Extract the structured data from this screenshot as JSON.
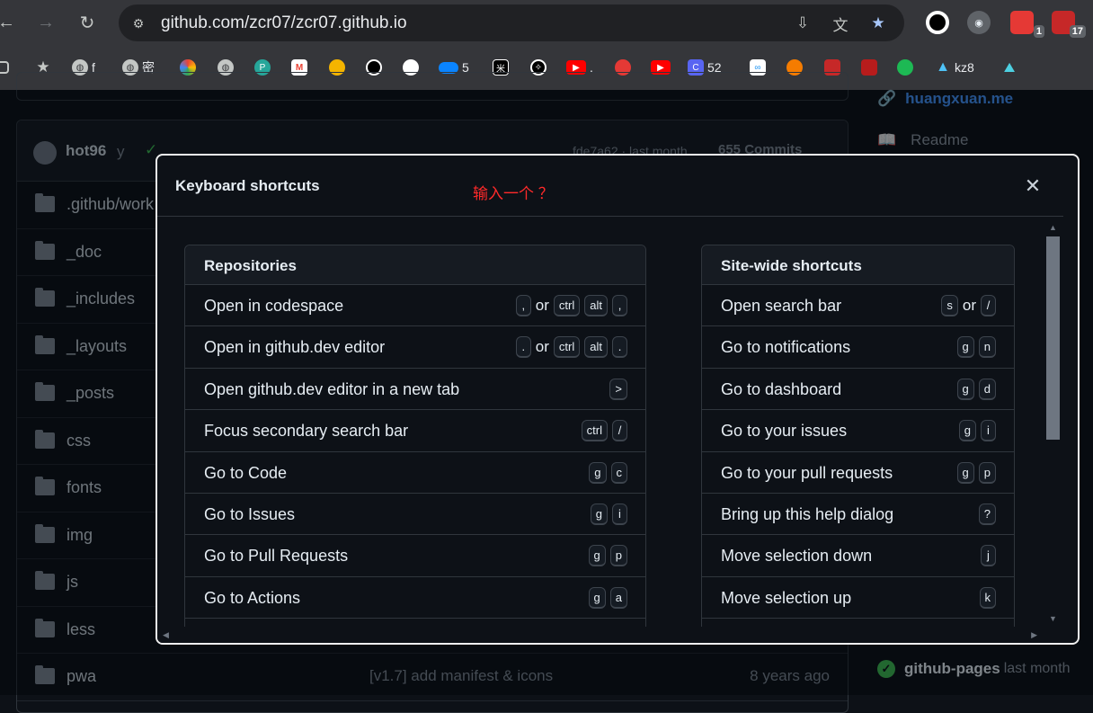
{
  "browser": {
    "url": "github.com/zcr07/zcr07.github.io",
    "extensions": [
      {
        "name": "obs-icon",
        "badge": ""
      },
      {
        "name": "owl-icon",
        "badge": ""
      },
      {
        "name": "red-ext-icon",
        "badge": "1"
      },
      {
        "name": "pdf-ext-icon",
        "badge": "17"
      }
    ],
    "bookmarks": [
      {
        "icon": "star-icon",
        "label": ""
      },
      {
        "icon": "globe-icon",
        "label": "f"
      },
      {
        "icon": "globe-icon",
        "label": "密"
      },
      {
        "icon": "photos-icon",
        "label": ""
      },
      {
        "icon": "globe-icon",
        "label": ""
      },
      {
        "icon": "pc-icon",
        "label": ""
      },
      {
        "icon": "gmail-icon",
        "label": ""
      },
      {
        "icon": "ball-icon",
        "label": ""
      },
      {
        "icon": "github-icon",
        "label": ""
      },
      {
        "icon": "github-icon",
        "label": ""
      },
      {
        "icon": "onedrive-icon",
        "label": "5"
      },
      {
        "icon": "mi-icon",
        "label": ""
      },
      {
        "icon": "openai-icon",
        "label": ""
      },
      {
        "icon": "youtube-icon",
        "label": "."
      },
      {
        "icon": "red-icon",
        "label": ""
      },
      {
        "icon": "youtube-icon",
        "label": ""
      },
      {
        "icon": "c-icon",
        "label": "52"
      },
      {
        "icon": "link-icon",
        "label": ""
      },
      {
        "icon": "orange-icon",
        "label": ""
      },
      {
        "icon": "square-icon",
        "label": ""
      },
      {
        "icon": "seal-icon",
        "label": ""
      },
      {
        "icon": "spotify-icon",
        "label": ""
      },
      {
        "icon": "triangle-icon",
        "label": "kz8"
      },
      {
        "icon": "mountain-icon",
        "label": ""
      }
    ]
  },
  "repo": {
    "author": "hot96",
    "author_suffix": "y",
    "commit_hash": "fde7a62 · last month",
    "commit_count": "655 Commits",
    "files": [
      {
        "name": ".github/work",
        "msg": "",
        "age": ""
      },
      {
        "name": "_doc",
        "msg": "",
        "age": ""
      },
      {
        "name": "_includes",
        "msg": "",
        "age": ""
      },
      {
        "name": "_layouts",
        "msg": "",
        "age": ""
      },
      {
        "name": "_posts",
        "msg": "",
        "age": ""
      },
      {
        "name": "css",
        "msg": "",
        "age": ""
      },
      {
        "name": "fonts",
        "msg": "",
        "age": ""
      },
      {
        "name": "img",
        "msg": "",
        "age": ""
      },
      {
        "name": "js",
        "msg": "",
        "age": ""
      },
      {
        "name": "less",
        "msg": "",
        "age": ""
      },
      {
        "name": "pwa",
        "msg": "[v1.7] add manifest & icons",
        "age": "8 years ago"
      }
    ]
  },
  "sidebar": {
    "website": "huangxuan.me",
    "readme": "Readme",
    "deploy_name": "github-pages",
    "deploy_time": "last month"
  },
  "dialog": {
    "title": "Keyboard shortcuts",
    "note": "输入一个 ？",
    "left": {
      "title": "Repositories",
      "rows": [
        {
          "label": "Open in codespace",
          "keys": [
            ",",
            "or",
            "ctrl",
            "alt",
            ","
          ]
        },
        {
          "label": "Open in github.dev editor",
          "keys": [
            ".",
            "or",
            "ctrl",
            "alt",
            "."
          ]
        },
        {
          "label": "Open github.dev editor in a new tab",
          "keys": [
            ">"
          ]
        },
        {
          "label": "Focus secondary search bar",
          "keys": [
            "ctrl",
            "/"
          ]
        },
        {
          "label": "Go to Code",
          "keys": [
            "g",
            "c"
          ]
        },
        {
          "label": "Go to Issues",
          "keys": [
            "g",
            "i"
          ]
        },
        {
          "label": "Go to Pull Requests",
          "keys": [
            "g",
            "p"
          ]
        },
        {
          "label": "Go to Actions",
          "keys": [
            "g",
            "a"
          ]
        },
        {
          "label": "",
          "keys": []
        }
      ]
    },
    "right": {
      "title": "Site-wide shortcuts",
      "rows": [
        {
          "label": "Open search bar",
          "keys": [
            "s",
            "or",
            "/"
          ]
        },
        {
          "label": "Go to notifications",
          "keys": [
            "g",
            "n"
          ]
        },
        {
          "label": "Go to dashboard",
          "keys": [
            "g",
            "d"
          ]
        },
        {
          "label": "Go to your issues",
          "keys": [
            "g",
            "i"
          ]
        },
        {
          "label": "Go to your pull requests",
          "keys": [
            "g",
            "p"
          ]
        },
        {
          "label": "Bring up this help dialog",
          "keys": [
            "?"
          ]
        },
        {
          "label": "Move selection down",
          "keys": [
            "j"
          ]
        },
        {
          "label": "Move selection up",
          "keys": [
            "k"
          ]
        },
        {
          "label": "",
          "keys": []
        }
      ]
    }
  }
}
